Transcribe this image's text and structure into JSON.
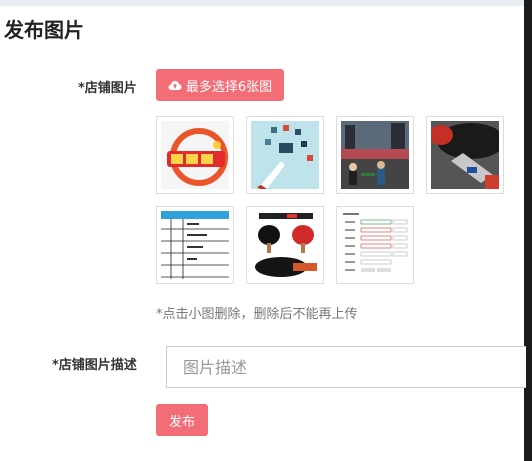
{
  "page": {
    "title": "发布图片"
  },
  "form": {
    "images_label": "*店铺图片",
    "upload_button": "最多选择6张图",
    "hint": "*点击小图删除，删除后不能再上传",
    "description_label": "*店铺图片描述",
    "description_placeholder": "图片描述",
    "submit_button": "发布"
  },
  "thumbnails": [
    {
      "name": "thumb-welfare-logo",
      "icon": "fuli-text-image"
    },
    {
      "name": "thumb-app-icons-megaphone",
      "icon": "megaphone-image"
    },
    {
      "name": "thumb-table-tennis-crowd",
      "icon": "crowd-photo"
    },
    {
      "name": "thumb-paddle-closeup",
      "icon": "paddle-photo"
    },
    {
      "name": "thumb-schedule-table",
      "icon": "table-screenshot"
    },
    {
      "name": "thumb-paddles-product",
      "icon": "paddles-product"
    },
    {
      "name": "thumb-form-screenshot",
      "icon": "form-screenshot"
    }
  ],
  "colors": {
    "accent": "#f36d77"
  }
}
